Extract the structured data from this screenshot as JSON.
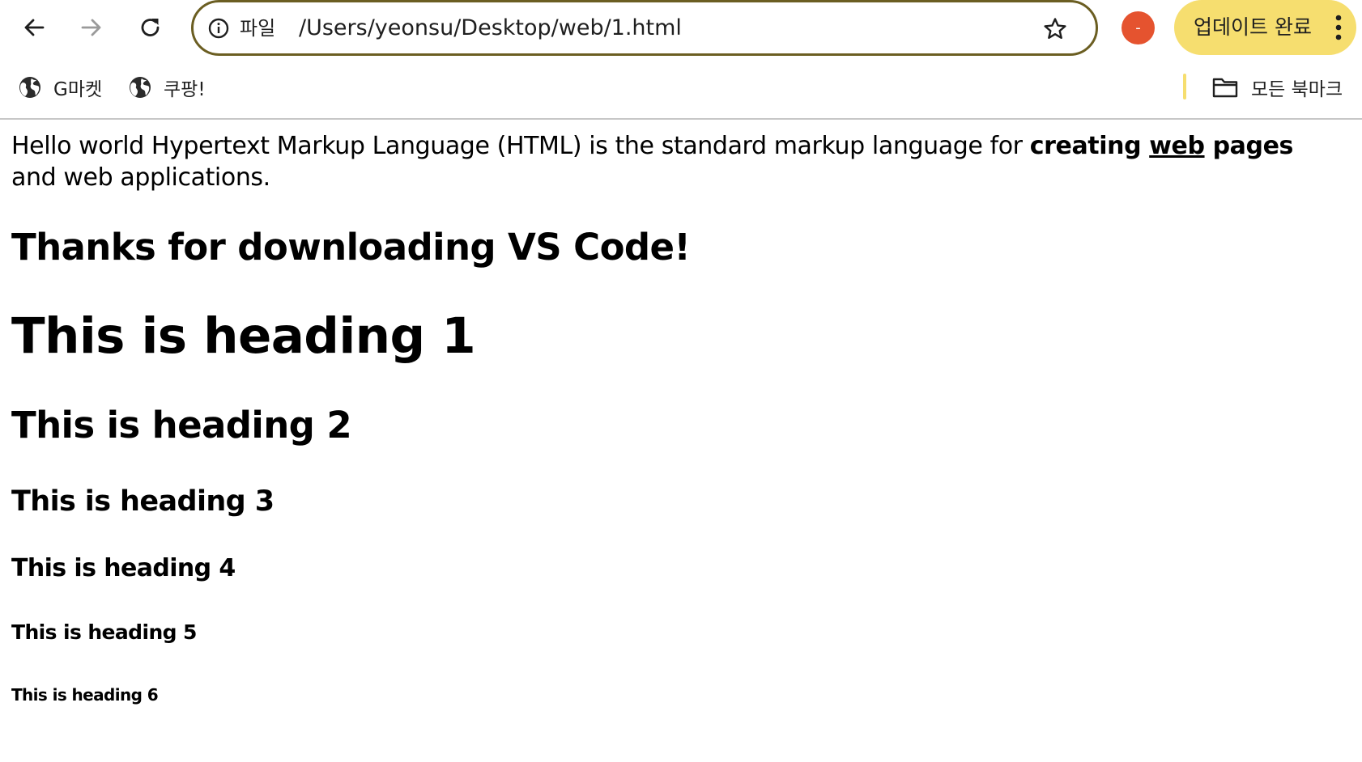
{
  "toolbar": {
    "back_icon": "arrow-left-icon",
    "forward_icon": "arrow-right-icon",
    "reload_icon": "reload-icon",
    "omnibox": {
      "info_icon": "info-icon",
      "scheme_label": "파일",
      "url": "/Users/yeonsu/Desktop/web/1.html",
      "star_icon": "star-icon"
    },
    "profile_badge": "-",
    "profile_color": "#e5532f",
    "update_button_label": "업데이트 완료",
    "update_button_color": "#f6de6f",
    "menu_icon": "kebab-menu-icon"
  },
  "bookmarks": {
    "items": [
      {
        "label": "G마켓",
        "icon": "globe-icon"
      },
      {
        "label": "쿠팡!",
        "icon": "globe-icon"
      }
    ],
    "all_bookmarks": {
      "label": "모든 북마크",
      "icon": "folder-icon"
    }
  },
  "page": {
    "paragraph": {
      "text_1": "Hello world Hypertext Markup Language (HTML) is the standard markup language for ",
      "bold_1": "creating ",
      "bold_underlined": "web",
      "bold_2": " pages",
      "text_2": " and web applications."
    },
    "thanks_heading": "Thanks for downloading VS Code!",
    "h1": "This is heading 1",
    "h2": "This is heading 2",
    "h3": "This is heading 3",
    "h4": "This is heading 4",
    "h5": "This is heading 5",
    "h6": "This is heading 6"
  }
}
